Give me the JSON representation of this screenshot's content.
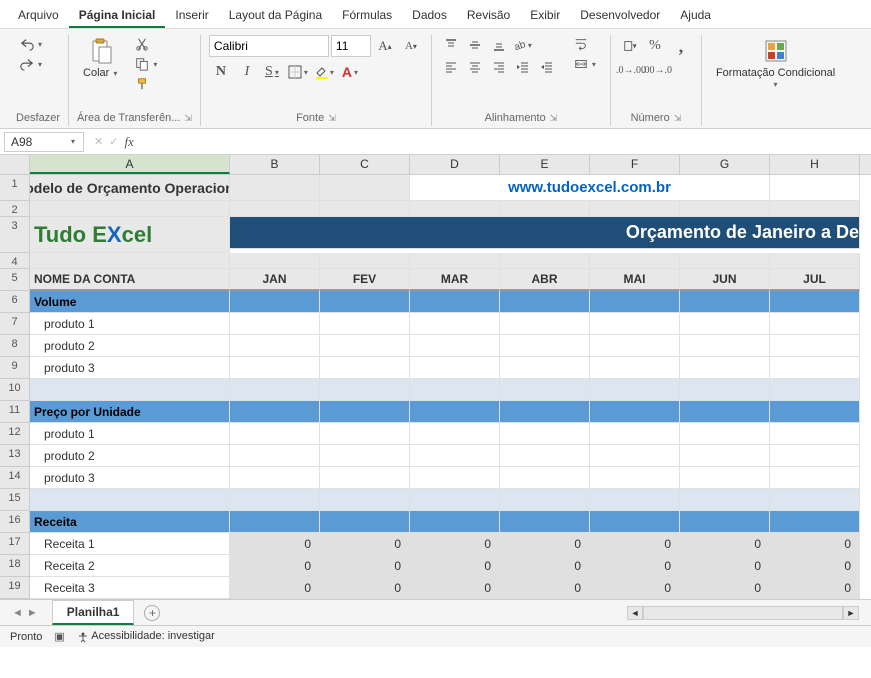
{
  "menubar": [
    "Arquivo",
    "Página Inicial",
    "Inserir",
    "Layout da Página",
    "Fórmulas",
    "Dados",
    "Revisão",
    "Exibir",
    "Desenvolvedor",
    "Ajuda"
  ],
  "menubar_active": 1,
  "ribbon": {
    "undo_group": "Desfazer",
    "clipboard_group": "Área de Transferên...",
    "paste_label": "Colar",
    "font_group": "Fonte",
    "font_name": "Calibri",
    "font_size": "11",
    "alignment_group": "Alinhamento",
    "number_group": "Número",
    "cond_fmt": "Formatação Condicional"
  },
  "name_box": "A98",
  "formula": "",
  "columns": [
    "A",
    "B",
    "C",
    "D",
    "E",
    "F",
    "G",
    "H"
  ],
  "rows": {
    "1": {
      "A": "Modelo de Orçamento Operacional",
      "url": "www.tudoexcel.com.br"
    },
    "3_banner": "Orçamento de Janeiro a De",
    "5": {
      "A": "NOME DA CONTA",
      "months": [
        "JAN",
        "FEV",
        "MAR",
        "ABR",
        "MAI",
        "JUN",
        "JUL"
      ]
    },
    "6": "Volume",
    "7": "produto 1",
    "8": "produto 2",
    "9": "produto 3",
    "11": "Preço por Unidade",
    "12": "produto 1",
    "13": "produto 2",
    "14": "produto 3",
    "16": "Receita",
    "17": {
      "label": "Receita 1",
      "vals": [
        "0",
        "0",
        "0",
        "0",
        "0",
        "0",
        "0"
      ]
    },
    "18": {
      "label": "Receita 2",
      "vals": [
        "0",
        "0",
        "0",
        "0",
        "0",
        "0",
        "0"
      ]
    },
    "19": {
      "label": "Receita 3",
      "vals": [
        "0",
        "0",
        "0",
        "0",
        "0",
        "0",
        "0"
      ]
    }
  },
  "row_numbers": [
    "1",
    "2",
    "3",
    "4",
    "5",
    "6",
    "7",
    "8",
    "9",
    "10",
    "11",
    "12",
    "13",
    "14",
    "15",
    "16",
    "17",
    "18",
    "19"
  ],
  "sheet_tab": "Planilha1",
  "status": {
    "ready": "Pronto",
    "accessibility": "Acessibilidade: investigar"
  },
  "logo": {
    "part1": "Tudo E",
    "part2": "X",
    "part3": "cel"
  }
}
